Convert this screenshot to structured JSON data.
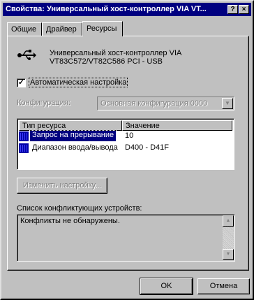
{
  "window": {
    "title": "Свойства: Универсальный хост-контроллер VIA VT...",
    "help_label": "?",
    "close_label": "×"
  },
  "tabs": [
    {
      "label": "Общие"
    },
    {
      "label": "Драйвер"
    },
    {
      "label": "Ресурсы"
    }
  ],
  "device": {
    "icon": "usb-icon",
    "name_line1": "Универсальный хост-контроллер VIA",
    "name_line2": "VT83C572/VT82C586 PCI - USB"
  },
  "auto_config": {
    "label": "Автоматическая настройка",
    "checked": true,
    "check_mark": "✓"
  },
  "configuration": {
    "label": "Конфигурация:",
    "value": "Основная конфигурация 0000",
    "arrow": "▼"
  },
  "resources": {
    "columns": [
      "Тип ресурса",
      "Значение"
    ],
    "rows": [
      {
        "type": "Запрос на прерывание",
        "value": "10",
        "selected": true
      },
      {
        "type": "Диапазон ввода/вывода",
        "value": "D400 - D41F",
        "selected": false
      }
    ]
  },
  "change_settings": {
    "label": "Изменить настройку..."
  },
  "conflicts": {
    "label": "Список конфликтующих устройств:",
    "text": "Конфликты не обнаружены.",
    "scroll_up": "▲",
    "scroll_down": "▼"
  },
  "buttons": {
    "ok": "OK",
    "cancel": "Отмена"
  },
  "colors": {
    "titlebar": "#000080",
    "selection": "#000080",
    "face": "#c0c0c0"
  }
}
